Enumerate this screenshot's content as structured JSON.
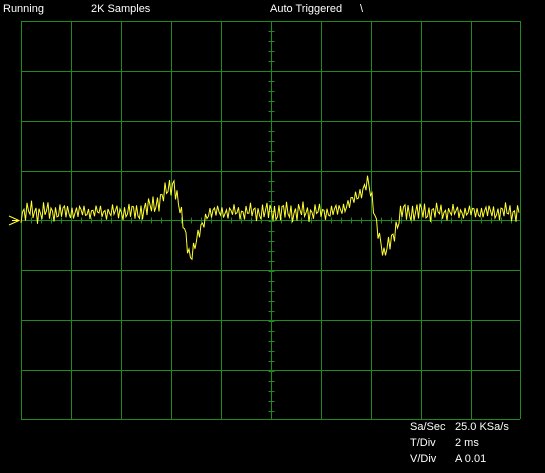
{
  "status_bar": {
    "run_state": "Running",
    "samples": "2K Samples",
    "trigger_mode": "Auto Triggered",
    "trigger_slope_symbol": "\\"
  },
  "readout": {
    "sa_sec_label": "Sa/Sec",
    "sa_sec_value": "25.0 KSa/s",
    "t_div_label": "T/Div",
    "t_div_value": "2 ms",
    "v_div_label": "V/Div",
    "v_div_value": "A 0.01"
  },
  "colors": {
    "background": "#000000",
    "grid": "#1f8a1f",
    "trace": "#ffff33",
    "marker": "#ffff33",
    "text": "#ffffff"
  },
  "icons": {
    "trigger_slope": "falling-edge-icon",
    "channel_marker": "channel-ground-arrow-icon"
  }
}
